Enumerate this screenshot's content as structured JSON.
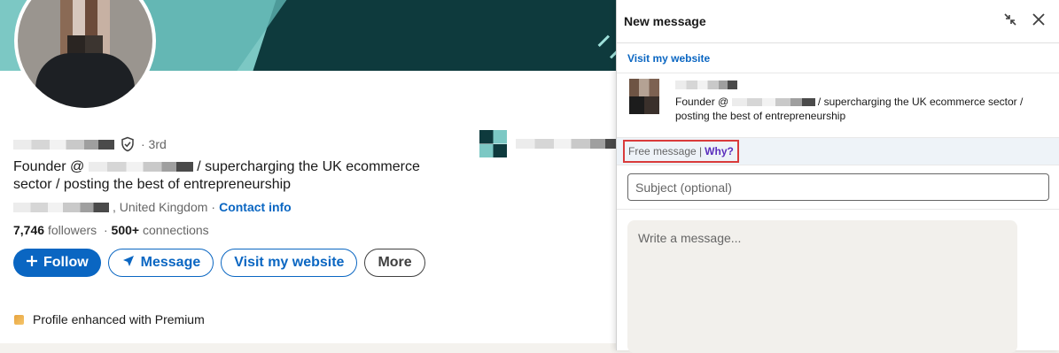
{
  "profile": {
    "degree": "· 3rd",
    "headline_prefix": "Founder @",
    "headline_suffix": "/ supercharging the UK ecommerce sector / posting the best of entrepreneurship",
    "location": ", United Kingdom",
    "location_sep": "·",
    "contact_info": "Contact info",
    "followers_count": "7,746",
    "followers_label": "followers",
    "connections_count": "500+",
    "connections_label": "connections",
    "actions": {
      "follow": "Follow",
      "message": "Message",
      "visit_website": "Visit my website",
      "more": "More"
    },
    "premium_text": "Profile enhanced with Premium"
  },
  "message_panel": {
    "title": "New message",
    "visit_link": "Visit my website",
    "recipient": {
      "headline_prefix": "Founder @",
      "headline_suffix": "/ supercharging the UK ecommerce sector / posting the best of entrepreneurship"
    },
    "free_message": "Free message |",
    "why": "Why?",
    "subject_placeholder": "Subject (optional)",
    "message_placeholder": "Write a message..."
  },
  "colors": {
    "brand_blue": "#0a66c2",
    "highlight_red": "#d93b3b",
    "why_purple": "#5b2fbd"
  }
}
